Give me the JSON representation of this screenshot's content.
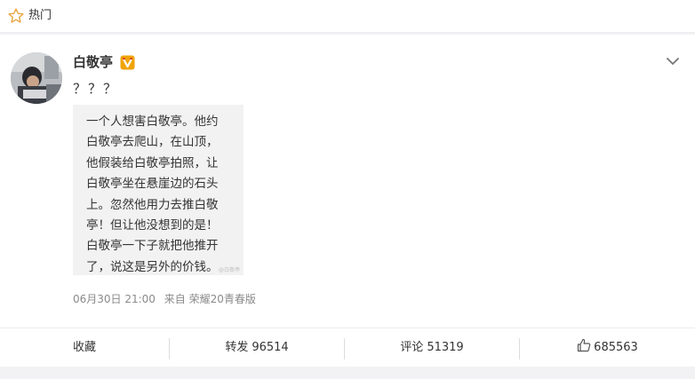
{
  "header": {
    "title": "热门",
    "icon": "star-outline-icon",
    "accent": "#e8a33d"
  },
  "post": {
    "username": "白敬亭",
    "verified_badge": "v-verified-icon",
    "text": "？？？",
    "image_caption": "一个人想害白敬亭。他约\n白敬亭去爬山，在山顶，\n他假装给白敬亭拍照，让\n白敬亭坐在悬崖边的石头\n上。忽然他用力去推白敬\n亭！但让他没想到的是！\n白敬亭一下子就把他推开\n了，说这是另外的价钱。",
    "image_watermark": "@白敬亭",
    "time": "06月30日 21:00",
    "source_prefix": "来自",
    "source": "荣耀20青春版"
  },
  "actions": {
    "favorite_label": "收藏",
    "repost_label": "转发",
    "repost_count": "96514",
    "comment_label": "评论",
    "comment_count": "51319",
    "like_count": "685563"
  }
}
